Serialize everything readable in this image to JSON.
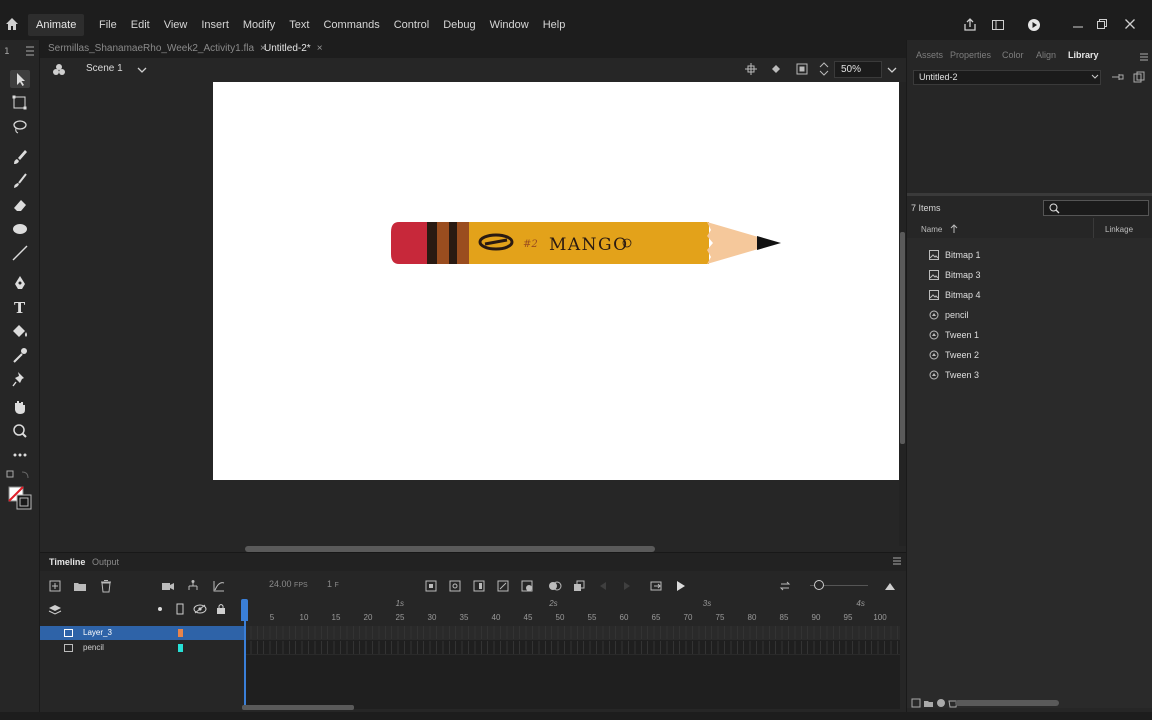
{
  "app": {
    "name": "Animate",
    "menu": [
      "File",
      "Edit",
      "View",
      "Insert",
      "Modify",
      "Text",
      "Commands",
      "Control",
      "Debug",
      "Window",
      "Help"
    ]
  },
  "documents": {
    "tabs": [
      {
        "label": "Sermillas_ShanamaeRho_Week2_Activity1.fla"
      },
      {
        "label": "Untitled-2*"
      }
    ],
    "close_glyph": "×"
  },
  "editbar": {
    "scene": "Scene 1",
    "zoom": "50%"
  },
  "stage": {
    "pencil_text": "MANGO",
    "pencil_small_text": "#2",
    "colors": {
      "eraser": "#c7283a",
      "ferrule_dark": "#2a1a12",
      "ferrule_brown": "#9a4d1f",
      "body": "#e3a21a",
      "wood": "#f5c89b",
      "lead": "#111111"
    }
  },
  "timeline": {
    "tabs": [
      "Timeline",
      "Output"
    ],
    "fps": "24.00",
    "fps_unit": "FPS",
    "frame": "1",
    "frame_unit": "F",
    "seconds": [
      "1s",
      "2s",
      "3s",
      "4s"
    ],
    "ticks": [
      "5",
      "10",
      "15",
      "20",
      "25",
      "30",
      "35",
      "40",
      "45",
      "50",
      "55",
      "60",
      "65",
      "70",
      "75",
      "80",
      "85",
      "90",
      "95",
      "100"
    ],
    "layers": [
      {
        "name": "Layer_3",
        "color": "#e8844a",
        "selected": true
      },
      {
        "name": "pencil",
        "color": "#27e0d6",
        "selected": false
      }
    ]
  },
  "right_panel": {
    "tabs": [
      "Assets",
      "Properties",
      "Color",
      "Align",
      "Library"
    ],
    "active_tab": "Library",
    "library_doc": "Untitled-2",
    "items_count": "7 Items",
    "columns": {
      "name": "Name",
      "linkage": "Linkage"
    },
    "items": [
      {
        "name": "Bitmap 1",
        "icon": "bitmap-icon"
      },
      {
        "name": "Bitmap 3",
        "icon": "bitmap-icon"
      },
      {
        "name": "Bitmap 4",
        "icon": "bitmap-icon"
      },
      {
        "name": "pencil",
        "icon": "graphic-symbol-icon"
      },
      {
        "name": "Tween 1",
        "icon": "graphic-symbol-icon"
      },
      {
        "name": "Tween 2",
        "icon": "graphic-symbol-icon"
      },
      {
        "name": "Tween 3",
        "icon": "graphic-symbol-icon"
      }
    ]
  }
}
